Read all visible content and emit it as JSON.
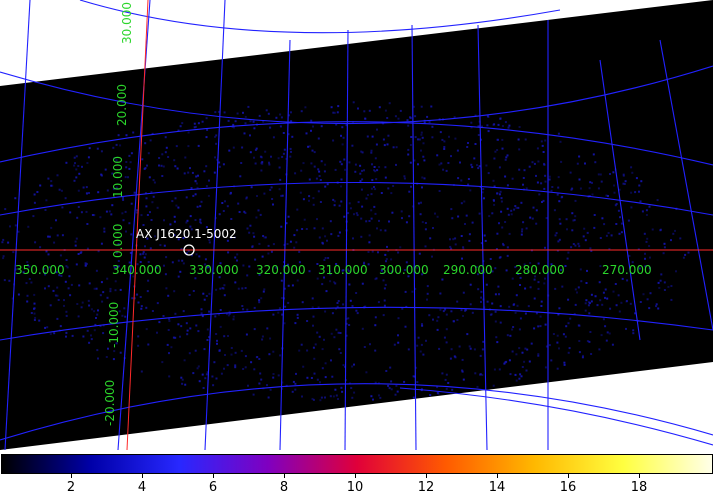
{
  "viewer": {
    "source_label": "AX J1620.1-5002",
    "colors": {
      "background": "#000000",
      "grid": "#2222ff",
      "crosshair": "#ff2a2a",
      "labels": "#22dd22",
      "noise": "#1414aa"
    },
    "x_axis_labels": [
      "350.000",
      "340.000",
      "330.000",
      "320.000",
      "310.000",
      "300.000",
      "290.000",
      "280.000",
      "270.000"
    ],
    "y_axis_labels": [
      "30.000",
      "20.000",
      "10.000",
      "0.000",
      "-10.000",
      "-20.000"
    ]
  },
  "colorbar": {
    "stops": [
      "#000000",
      "#0000a8",
      "#2828ff",
      "#8000c0",
      "#e0003a",
      "#ff5a00",
      "#ffb800",
      "#ffff40",
      "#ffffe8"
    ],
    "tick_labels": [
      "2",
      "4",
      "6",
      "8",
      "10",
      "12",
      "14",
      "16",
      "18"
    ]
  }
}
